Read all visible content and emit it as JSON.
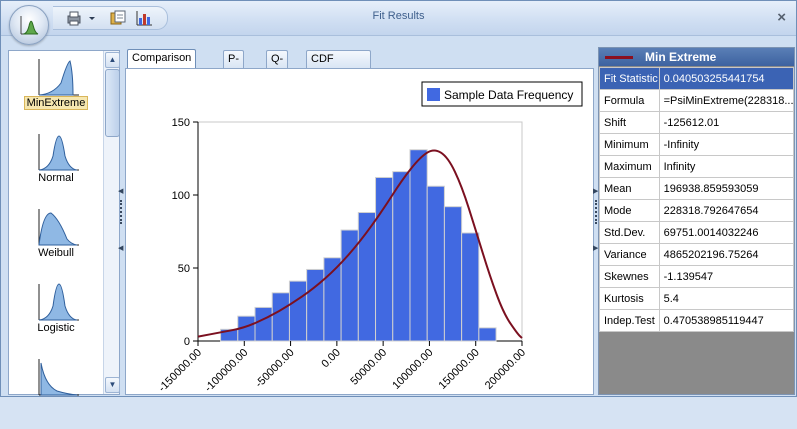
{
  "window": {
    "title": "Fit Results",
    "close_glyph": "×"
  },
  "toolbar": {
    "icons": [
      "app-menu-icon",
      "print-icon",
      "dropdown-icon",
      "copy-icon",
      "chart-icon"
    ]
  },
  "gallery": {
    "items": [
      {
        "label": "MinExtreme",
        "selected": true,
        "shape": "minextreme"
      },
      {
        "label": "Normal",
        "selected": false,
        "shape": "normal"
      },
      {
        "label": "Weibull",
        "selected": false,
        "shape": "weibull"
      },
      {
        "label": "Logistic",
        "selected": false,
        "shape": "logistic"
      },
      {
        "label": "",
        "selected": false,
        "shape": "exponential"
      }
    ]
  },
  "tabs": [
    {
      "label": "Comparison Chart",
      "active": true
    },
    {
      "label": "P-P",
      "active": false
    },
    {
      "label": "Q-Q",
      "active": false
    },
    {
      "label": "CDF Differences",
      "active": false
    }
  ],
  "chart_data": {
    "type": "bar",
    "title": "",
    "xlabel": "",
    "ylabel": "",
    "legend": {
      "entry": "Sample Data Frequency",
      "placement": "top-right"
    },
    "bar_color": "#4169e1",
    "curve_color": "#7b1020",
    "ylim": [
      0,
      150
    ],
    "yticks": [
      "0",
      "50",
      "100",
      "150"
    ],
    "xticks": [
      "-150000.00",
      "-100000.00",
      "-50000.00",
      "0.00",
      "50000.00",
      "100000.00",
      "150000.00",
      "200000.00"
    ],
    "x_range": [
      -150000,
      200000
    ],
    "bin_start": -125612.01,
    "bin_width": 18600,
    "values": [
      8,
      17,
      23,
      33,
      41,
      49,
      57,
      76,
      88,
      112,
      116,
      131,
      106,
      92,
      74,
      9
    ],
    "fit_curve": [
      [
        -150000,
        3
      ],
      [
        -125000,
        6
      ],
      [
        -100000,
        9
      ],
      [
        -75000,
        16
      ],
      [
        -50000,
        25
      ],
      [
        -25000,
        36
      ],
      [
        0,
        50
      ],
      [
        25000,
        68
      ],
      [
        50000,
        90
      ],
      [
        70000,
        110
      ],
      [
        90000,
        126
      ],
      [
        105000,
        132
      ],
      [
        120000,
        126
      ],
      [
        135000,
        106
      ],
      [
        150000,
        76
      ],
      [
        165000,
        45
      ],
      [
        180000,
        19
      ],
      [
        195000,
        5
      ],
      [
        200000,
        2
      ]
    ]
  },
  "results": {
    "header": "Min Extreme",
    "curve_color": "#7b1020",
    "rows": [
      {
        "key": "Fit Statistic",
        "value": "0.040503255441754",
        "selected": true
      },
      {
        "key": "Formula",
        "value": "=PsiMinExtreme(228318...",
        "selected": false
      },
      {
        "key": "Shift",
        "value": "-125612.01",
        "selected": false
      },
      {
        "key": "Minimum",
        "value": "-Infinity",
        "selected": false
      },
      {
        "key": "Maximum",
        "value": "Infinity",
        "selected": false
      },
      {
        "key": "Mean",
        "value": "196938.859593059",
        "selected": false
      },
      {
        "key": "Mode",
        "value": "228318.792647654",
        "selected": false
      },
      {
        "key": "Std.Dev.",
        "value": "69751.0014032246",
        "selected": false
      },
      {
        "key": "Variance",
        "value": "4865202196.75264",
        "selected": false
      },
      {
        "key": "Skewnes",
        "value": "-1.139547",
        "selected": false
      },
      {
        "key": "Kurtosis",
        "value": "5.4",
        "selected": false
      },
      {
        "key": "Indep.Test",
        "value": "0.470538985119447",
        "selected": false
      }
    ]
  }
}
